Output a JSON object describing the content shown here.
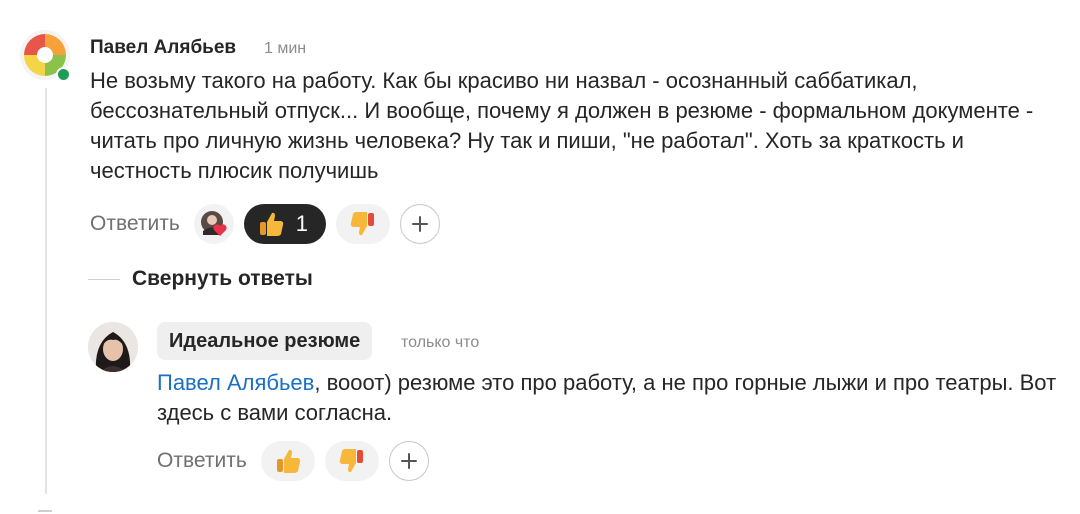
{
  "comment": {
    "author": "Павел Алябьев",
    "time": "1 мин",
    "text": "Не возьму такого на работу. Как бы красиво ни назвал - осознанный саббатикал, бессознательный отпуск... И вообще, почему я должен в резюме - формальном документе - читать про личную жизнь человека? Ну так и пиши, \"не работал\". Хоть за краткость и честность плюсик получишь",
    "reply_label": "Ответить",
    "like_count": "1",
    "reactions": [
      "avatar-heart-icon",
      "thumbs-up-icon",
      "thumbs-down-icon",
      "plus-icon"
    ]
  },
  "thread": {
    "collapse_label": "Свернуть ответы"
  },
  "reply": {
    "author": "Идеальное резюме",
    "time": "только что",
    "mention": "Павел Алябьев",
    "text": ", вооот) резюме это про работу, а не про горные лыжи и про театры. Вот здесь с вами согласна.",
    "reply_label": "Ответить",
    "reactions": [
      "thumbs-up-icon",
      "thumbs-down-icon",
      "plus-icon"
    ]
  },
  "colors": {
    "mention": "#1b6fc4",
    "online": "#1f9d55",
    "dark_pill": "#262626",
    "muted": "#8c8c8c"
  }
}
